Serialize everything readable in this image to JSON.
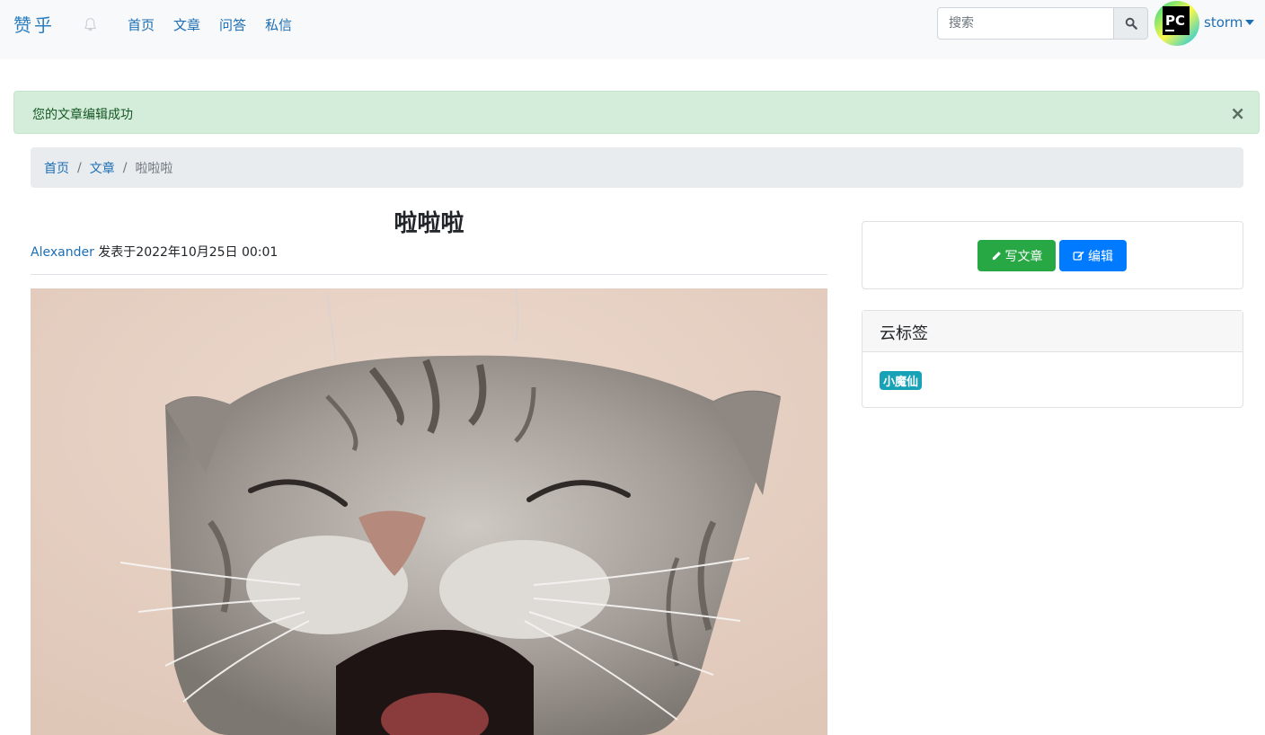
{
  "navbar": {
    "brand": "赞乎",
    "links": [
      "首页",
      "文章",
      "问答",
      "私信"
    ],
    "search_placeholder": "搜索",
    "user_name": "storm",
    "avatar_text": "PC"
  },
  "alert": {
    "message": "您的文章编辑成功",
    "close": "×"
  },
  "breadcrumb": {
    "items": [
      "首页",
      "文章"
    ],
    "active": "啦啦啦"
  },
  "article": {
    "title": "啦啦啦",
    "author": "Alexander",
    "published": "发表于2022年10月25日 00:01"
  },
  "sidebar": {
    "write_label": "写文章",
    "edit_label": "编辑",
    "tags_title": "云标签",
    "tags": [
      "小魔仙"
    ]
  },
  "colors": {
    "primary": "#007bff",
    "success": "#28a745",
    "info": "#17a2b8",
    "alert_bg": "#d4edda"
  }
}
